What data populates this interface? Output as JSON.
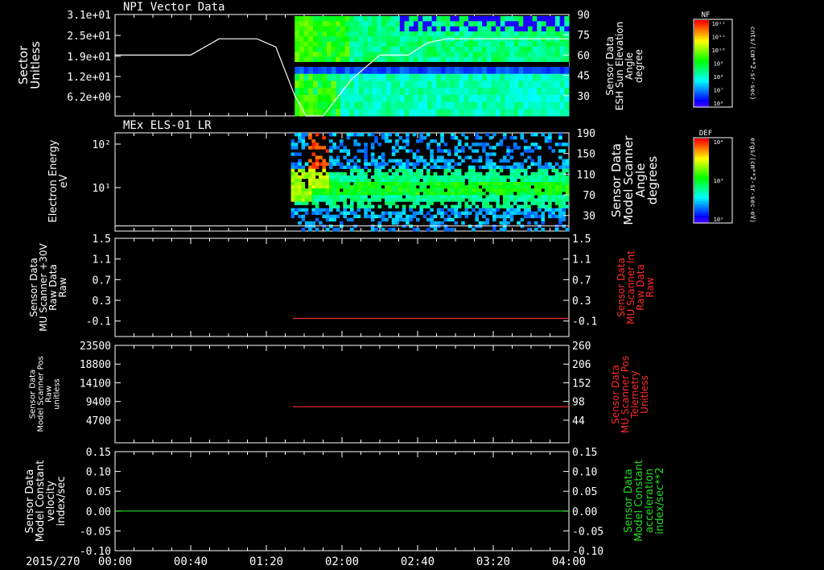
{
  "chart_data": [
    {
      "type": "heatmap",
      "title": "NPI Vector Data",
      "ylabel": "Sector Unitless",
      "yticks": [
        "3.1e+01",
        "2.5e+01",
        "1.9e+01",
        "1.2e+01",
        "6.2e+00"
      ],
      "ylabel_right": "Sensor Data ESH Sun Elevation Angle degree",
      "right_ticks": [
        "90",
        "75",
        "60",
        "45",
        "30"
      ],
      "right_range": [
        15,
        90
      ],
      "line_series": {
        "x_min": [
          0,
          40,
          55,
          75,
          85,
          95,
          101,
          110,
          125,
          140,
          155,
          165,
          175,
          240
        ],
        "y_deg": [
          60,
          60,
          72,
          72,
          66,
          30,
          15,
          15,
          42,
          60,
          60,
          69,
          72,
          72
        ]
      },
      "colorbar": {
        "label": "NF",
        "units": "cnts/(cm**2-sr-sec)",
        "ticks": [
          "10¹²",
          "10¹¹",
          "10¹⁰",
          "10⁹",
          "10⁸",
          "10⁷",
          "10⁶"
        ]
      }
    },
    {
      "type": "heatmap",
      "title": "MEx ELS-01 LR",
      "ylabel": "Electron Energy eV",
      "yticks": [
        "10²",
        "10¹"
      ],
      "ylabel_right": "Sensor Data Model Scanner Angle degrees",
      "right_ticks": [
        "190",
        "150",
        "110",
        "70",
        "30"
      ],
      "right_range": [
        0,
        190
      ],
      "line_series": {
        "x_min": [
          0,
          240
        ],
        "y_deg": [
          10,
          10
        ]
      },
      "colorbar": {
        "label": "DEF",
        "units": "ergs/(cm**2-sr-sec-eV)",
        "ticks": [
          "10⁴",
          "10³",
          "10²"
        ]
      }
    },
    {
      "type": "line",
      "ylabel": "Sensor Data MU Scanner +30V Raw Data Raw",
      "yticks": [
        "1.5",
        "1.1",
        "0.7",
        "0.3",
        "-0.1"
      ],
      "ylim": [
        -0.4,
        1.5
      ],
      "ylabel_right": "Sensor Data MU Scanner Int Raw Data Raw",
      "right_ticks": [
        "1.5",
        "1.1",
        "0.7",
        "0.3",
        "-0.1"
      ],
      "series": [
        {
          "x_min": [
            94,
            240
          ],
          "y": [
            -0.05,
            -0.05
          ],
          "color": "#ff2a2a"
        }
      ]
    },
    {
      "type": "line",
      "ylabel": "Sensor Data Model Scanner Pos Raw unitless",
      "yticks": [
        "23500",
        "18800",
        "14100",
        "9400",
        "4700"
      ],
      "ylim": [
        0,
        23500
      ],
      "ylabel_right": "Sensor Data MU Scanner Pos Telemetry Unitless",
      "right_ticks": [
        "260",
        "206",
        "152",
        "98",
        "44"
      ],
      "series": [
        {
          "x_min": [
            94,
            240
          ],
          "y": [
            8700,
            8700
          ],
          "color": "#ff2a2a"
        }
      ]
    },
    {
      "type": "line",
      "ylabel": "Sensor Data Model Constant velocity index/sec",
      "yticks": [
        "0.15",
        "0.10",
        "0.05",
        "0.00",
        "-0.05",
        "-0.10"
      ],
      "ylim": [
        -0.1,
        0.15
      ],
      "ylabel_right": "Sensor Data Model Constant acceleration index/sec**2",
      "right_ticks": [
        "0.15",
        "0.10",
        "0.05",
        "0.00",
        "-0.05",
        "-0.10"
      ],
      "series": [
        {
          "x_min": [
            0,
            240
          ],
          "y": [
            0.0,
            0.0
          ],
          "color": "#22dd22"
        }
      ]
    }
  ],
  "x_axis": {
    "date": "2015/270",
    "ticks": [
      "00:00",
      "00:40",
      "01:20",
      "02:00",
      "02:40",
      "03:20",
      "04:00"
    ],
    "range_min": [
      0,
      240
    ]
  },
  "colors": {
    "red_line": "#ff2a2a",
    "green_line": "#22dd22",
    "frame": "#ffffff"
  }
}
